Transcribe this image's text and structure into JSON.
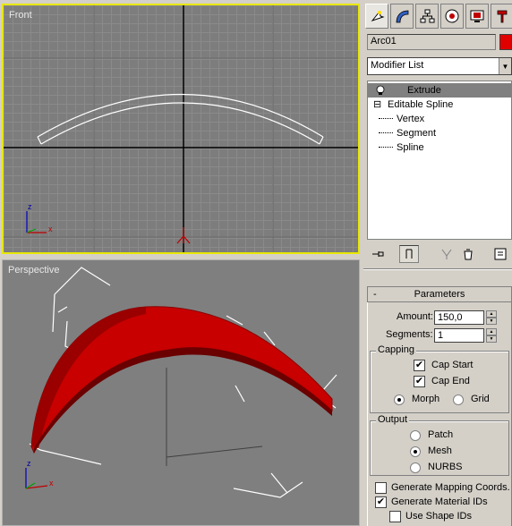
{
  "viewports": {
    "front": {
      "label": "Front",
      "axis_z": "z",
      "axis_x": "x"
    },
    "perspective": {
      "label": "Perspective",
      "axis_z": "z",
      "axis_x": "x"
    }
  },
  "command_panel": {
    "tabs": [
      "create-icon",
      "modify-icon",
      "hierarchy-icon",
      "motion-icon",
      "display-icon",
      "utilities-icon"
    ],
    "object_name": "Arc01",
    "object_color": "#e00000",
    "modifier_list": "Modifier List",
    "stack": [
      {
        "label": "Extrude",
        "selected": true
      },
      {
        "label": "Editable Spline",
        "selected": false
      },
      {
        "label": "Vertex",
        "selected": false
      },
      {
        "label": "Segment",
        "selected": false
      },
      {
        "label": "Spline",
        "selected": false
      }
    ],
    "stack_toggle": "⊟"
  },
  "parameters": {
    "title": "Parameters",
    "collapse": "-",
    "amount_label": "Amount:",
    "amount_value": "150,0",
    "segments_label": "Segments:",
    "segments_value": "1",
    "capping": {
      "title": "Capping",
      "cap_start": "Cap Start",
      "cap_start_checked": true,
      "cap_end": "Cap End",
      "cap_end_checked": true,
      "morph": "Morph",
      "grid": "Grid",
      "selected": "Morph"
    },
    "output": {
      "title": "Output",
      "patch": "Patch",
      "mesh": "Mesh",
      "nurbs": "NURBS",
      "selected": "Mesh"
    },
    "gen_mapping": "Generate Mapping Coords.",
    "gen_mapping_checked": false,
    "gen_material": "Generate Material IDs",
    "gen_material_checked": true,
    "use_shape": "Use Shape IDs",
    "use_shape_checked": false
  },
  "colors": {
    "viewport_bg": "#7d7d7d",
    "active_border": "#e8e800",
    "extrude_red": "#d40000"
  }
}
